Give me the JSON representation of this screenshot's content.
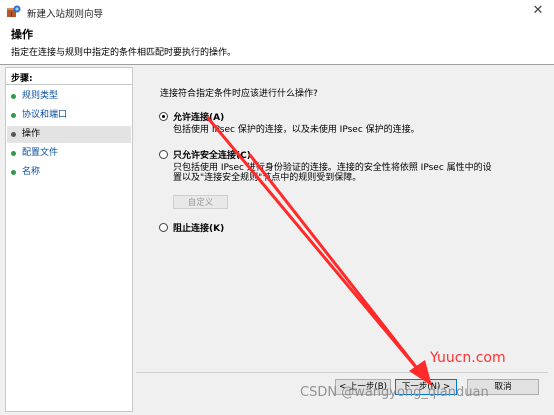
{
  "window": {
    "title": "新建入站规则向导",
    "close_glyph": "✕"
  },
  "header": {
    "title": "操作",
    "description": "指定在连接与规则中指定的条件相匹配时要执行的操作。"
  },
  "sidebar": {
    "heading": "步骤:",
    "items": [
      {
        "label": "规则类型",
        "active": false
      },
      {
        "label": "协议和端口",
        "active": false
      },
      {
        "label": "操作",
        "active": true
      },
      {
        "label": "配置文件",
        "active": false
      },
      {
        "label": "名称",
        "active": false
      }
    ]
  },
  "main": {
    "question": "连接符合指定条件时应该进行什么操作?",
    "options": [
      {
        "label": "允许连接(A)",
        "desc": [
          "包括使用 IPsec 保护的连接，以及未使用 IPsec 保护的连接。"
        ],
        "checked": true
      },
      {
        "label": "只允许安全连接(C)",
        "desc": [
          "只包括使用 IPsec 进行身份验证的连接。连接的安全性将依照 IPsec 属性中的设",
          "置以及\"连接安全规则\"节点中的规则受到保障。"
        ],
        "checked": false
      },
      {
        "label": "阻止连接(K)",
        "desc": [],
        "checked": false
      }
    ],
    "custom_button": "自定义"
  },
  "footer": {
    "back": "< 上一步(B)",
    "next": "下一步(N) >",
    "cancel": "取消"
  },
  "overlay": {
    "watermark": "CSDN @wangyong_qianduan",
    "site": "Yuucn.com",
    "arrow_color": "#ff2a2a"
  }
}
